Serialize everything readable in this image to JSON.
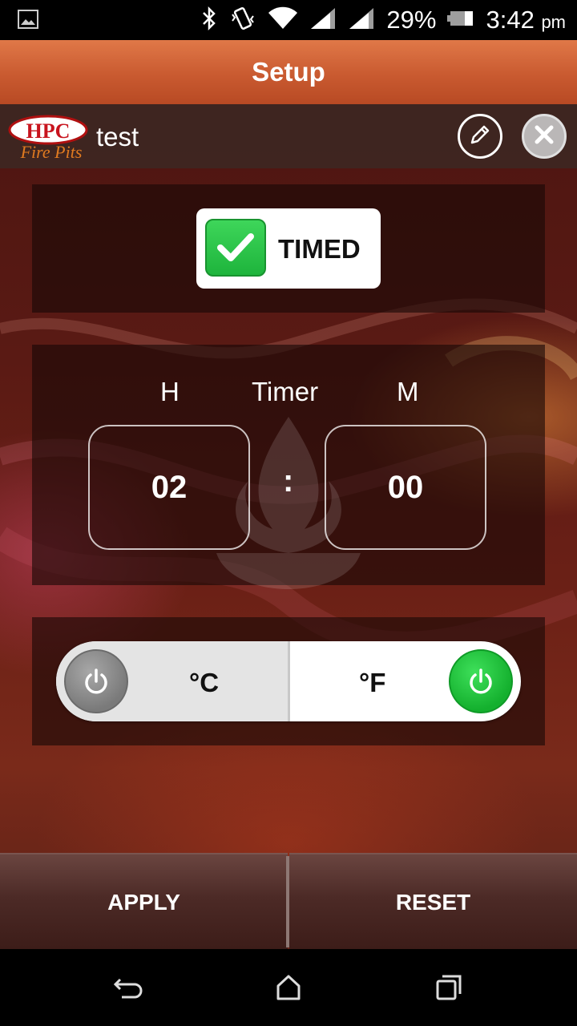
{
  "status_bar": {
    "battery_percent": "29%",
    "time": "3:42",
    "time_suffix": "pm",
    "icons": [
      "image-icon",
      "bluetooth-icon",
      "vibrate-icon",
      "wifi-icon",
      "signal-icon",
      "signal-icon",
      "battery-icon"
    ]
  },
  "header": {
    "title": "Setup"
  },
  "device": {
    "logo_text": "HPC Fire Pits",
    "name": "test",
    "edit_icon": "pencil-icon",
    "close_icon": "close-icon"
  },
  "timed": {
    "label": "TIMED",
    "checked": true
  },
  "timer": {
    "hours_label": "H",
    "title": "Timer",
    "minutes_label": "M",
    "hours_value": "02",
    "separator": ":",
    "minutes_value": "00"
  },
  "units": {
    "celsius_label": "°C",
    "fahrenheit_label": "°F",
    "selected": "°F",
    "icon": "power-icon"
  },
  "buttons": {
    "apply": "APPLY",
    "reset": "RESET"
  },
  "nav": {
    "back_icon": "back-icon",
    "home_icon": "home-icon",
    "recent_icon": "recent-apps-icon"
  },
  "colors": {
    "header_orange": "#c95a30",
    "check_green": "#1eb43c",
    "power_on_green": "#14b02e",
    "power_off_gray": "#7a7a7a"
  }
}
